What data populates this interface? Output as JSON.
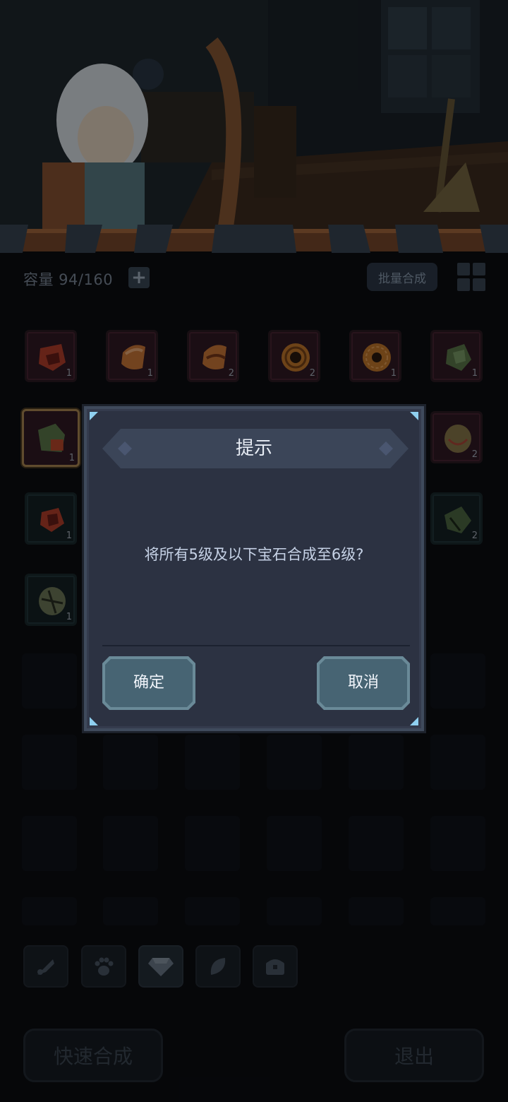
{
  "inventory": {
    "capacity_label": "容量 94/160",
    "add_icon": "plus-icon",
    "batch_label": "批量合成",
    "view_icon": "grid-view-icon"
  },
  "items": [
    {
      "gem": "red-gem-icon",
      "count": "1",
      "color": "#b8412c"
    },
    {
      "gem": "orange-gem-icon",
      "count": "1",
      "color": "#d07a3a"
    },
    {
      "gem": "orange-gem-icon",
      "count": "2",
      "color": "#d07a3a"
    },
    {
      "gem": "ring-gem-icon",
      "count": "2",
      "color": "#c67a2c"
    },
    {
      "gem": "ring-gem-icon",
      "count": "1",
      "color": "#c67a2c"
    },
    {
      "gem": "green-gem-icon",
      "count": "1",
      "color": "#5d7a4c"
    },
    {
      "gem": "green-gem-icon",
      "count": "1",
      "color": "#5d7a4c"
    },
    {
      "gem": "olive-gem-icon",
      "count": "2",
      "color": "#8a7a4c"
    },
    {
      "gem": "red-gem-icon",
      "count": "1",
      "color": "#b8412c"
    },
    {
      "gem": "green-gem-icon",
      "count": "2",
      "color": "#4f6a44"
    },
    {
      "gem": "olive-gem-icon",
      "count": "1",
      "color": "#6f7a5a"
    }
  ],
  "tabs": [
    {
      "icon": "weapon-icon"
    },
    {
      "icon": "paw-icon"
    },
    {
      "icon": "gem-icon"
    },
    {
      "icon": "leaf-icon"
    },
    {
      "icon": "chest-icon"
    }
  ],
  "footer": {
    "quick_merge": "快速合成",
    "exit": "退出"
  },
  "dialog": {
    "title": "提示",
    "message": "将所有5级及以下宝石合成至6级?",
    "confirm": "确定",
    "cancel": "取消"
  }
}
